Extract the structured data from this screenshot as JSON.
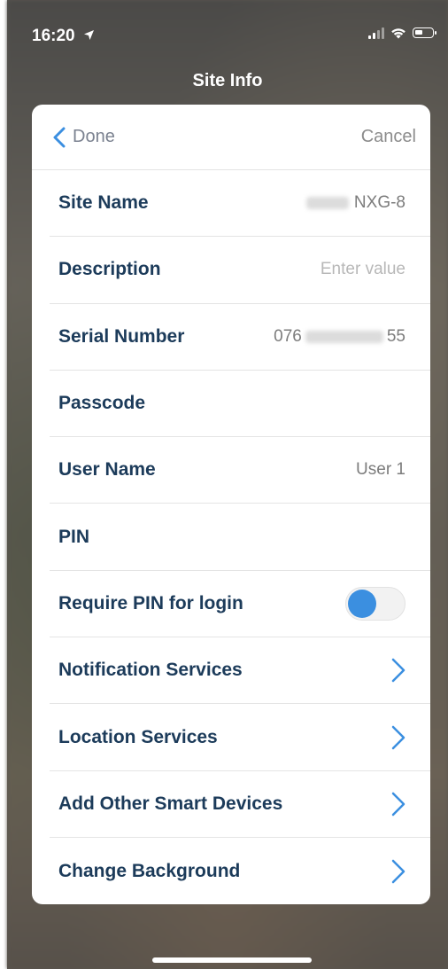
{
  "status_bar": {
    "time": "16:20",
    "location_arrow": "➤"
  },
  "screen": {
    "title": "Site Info"
  },
  "nav": {
    "done_label": "Done",
    "cancel_label": "Cancel"
  },
  "rows": {
    "site_name": {
      "label": "Site Name",
      "value_suffix": "NXG-8"
    },
    "description": {
      "label": "Description",
      "placeholder": "Enter value"
    },
    "serial_number": {
      "label": "Serial Number",
      "value_prefix": "076",
      "value_suffix": "55"
    },
    "passcode": {
      "label": "Passcode"
    },
    "user_name": {
      "label": "User Name",
      "value": "User 1"
    },
    "pin": {
      "label": "PIN"
    },
    "require_pin": {
      "label": "Require PIN for login",
      "enabled": false
    },
    "notification_services": {
      "label": "Notification Services"
    },
    "location_services": {
      "label": "Location Services"
    },
    "add_other_smart_devices": {
      "label": "Add Other Smart Devices"
    },
    "change_background": {
      "label": "Change Background"
    }
  },
  "colors": {
    "accent": "#3b8fe0",
    "label": "#1c3b5a",
    "value": "#7c7c7c"
  }
}
